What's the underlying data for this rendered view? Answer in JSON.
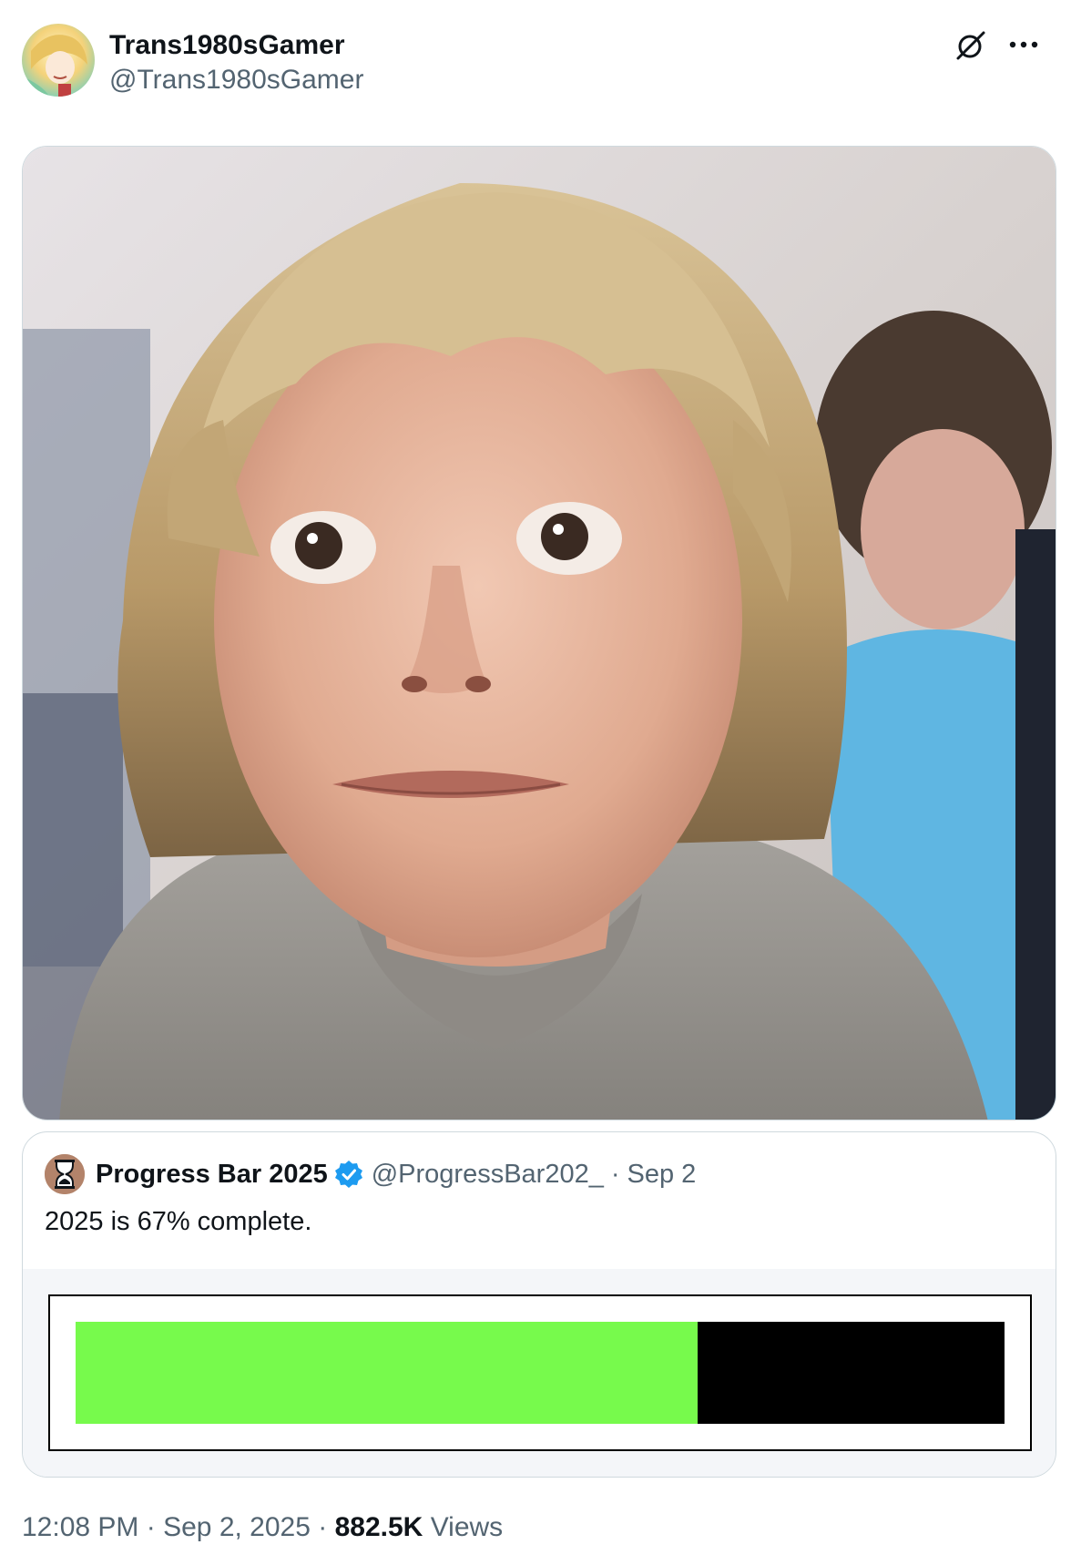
{
  "tweet": {
    "author": {
      "display_name": "Trans1980sGamer",
      "handle": "@Trans1980sGamer",
      "avatar_icon": "avatar"
    },
    "header_icons": [
      "grok-icon",
      "more-icon"
    ],
    "media": {
      "kind": "photo"
    },
    "quote": {
      "author": {
        "display_name": "Progress Bar 2025",
        "handle": "@ProgressBar202_",
        "verified": true,
        "avatar_icon": "hourglass-icon"
      },
      "separator": "·",
      "date": "Sep 2",
      "text": "2025 is 67% complete.",
      "progress": {
        "fraction": 0.67,
        "fill_color": "#77fa4c",
        "track_color": "#000000"
      }
    },
    "meta": {
      "time": "12:08 PM",
      "separator": "·",
      "date": "Sep 2, 2025",
      "views_count": "882.5K",
      "views_label": "Views"
    }
  },
  "colors": {
    "text_primary": "#0f1419",
    "text_secondary": "#536471",
    "border": "#cfd9de",
    "verified_blue": "#1d9bf0"
  }
}
